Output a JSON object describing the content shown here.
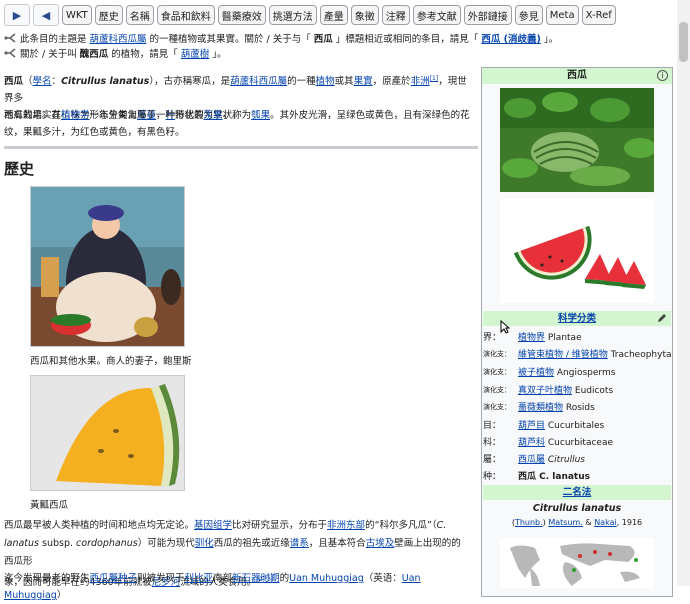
{
  "toolbar": {
    "forward_glyph": "▶",
    "back_glyph": "◀",
    "tabs": [
      "WKT",
      "歷史",
      "名稱",
      "食品和飲料",
      "醫藥療效",
      "挑選方法",
      "產量",
      "象徵",
      "注釋",
      "参考文献",
      "外部鏈接",
      "參見",
      "Meta",
      "X-Ref"
    ]
  },
  "hatnotes": {
    "line1": {
      "a": "此条目的主題是",
      "b": "葫蘆科西瓜屬",
      "c": "的一種植物或其果實。關於 / 关于与「",
      "d": "西瓜",
      "e": "」標題相近或相同的条目，請見「",
      "f": "西瓜 (消歧義)",
      "g": "」。"
    },
    "line2": {
      "a": "關於 / 关于叫",
      "b": "醜西瓜",
      "c": "的植物，請見「",
      "d": "葫蘆樹",
      "e": "」。"
    }
  },
  "intro": {
    "p1": {
      "t1": "西瓜",
      "t2": "（",
      "t3": "學名",
      "t4": "：",
      "t5": "Citrullus lanatus",
      "t6": "），古亦稱寒瓜，是",
      "t7": "葫蘆科西瓜屬",
      "t8": "的一種",
      "t9": "植物",
      "t10": "或其",
      "t11": "果實",
      "t12": "，原產於",
      "t13": "非洲",
      "t14": "[1]",
      "t15": "，現世界多",
      "line2a": "地有栽培。其植株为一年生匍匐",
      "line2b": "藤蔓",
      "line2c": "，",
      "line2d": "叶",
      "line2e": "形状裂为掌状。"
    },
    "p2": {
      "t1": "西瓜的果实在",
      "t2": "植物学",
      "t3": "形态分类上屬于一种特化的",
      "t4": "浆果",
      "t5": "，称为",
      "t6": "瓠果",
      "t7": "。其外皮光滑，呈绿色或黄色，且有深绿色的花",
      "line2": "纹，果瓤多汁，为红色或黄色，有黑色籽。"
    }
  },
  "history": {
    "heading": "歷史",
    "caption1": "西瓜和其他水果。商人的妻子，鲍里斯",
    "caption2": "黃瓤西瓜",
    "p1": {
      "t1": "西瓜最早被人类种植的时间和地点均无定论。",
      "t2": "基因组学",
      "t3": "比对研究显示，分布于",
      "t4": "非洲东部",
      "t5": "的“科尔多凡瓜”（",
      "t6": "C.",
      "l2a": "lanatus",
      "l2b": " subsp. ",
      "l2c": "cordophanus",
      "l2d": "）可能为现代",
      "l2e": "驯化",
      "l2f": "西瓜的祖先或近缘",
      "l2g": "谱系",
      "l2h": "，且基本符合",
      "l2i": "古埃及",
      "l2j": "壁画上出现的的西瓜形",
      "l3a": "象，因而可能早在约4360年前就被",
      "l3b": "尼罗河",
      "l3c": "流域的人类食用。",
      "l3d": "[2][3]"
    },
    "p2": {
      "t1": "迄今发现最老的野生",
      "t2": "西瓜屬种子",
      "t3": "则被发现于",
      "t4": "利比亚",
      "t5": "南部",
      "t6": "新石器时期",
      "t7": "的",
      "t8": "Uan Muhuggiag",
      "t9": "（英语：",
      "t10": "Uan Muhuggiag",
      "t11": "）"
    }
  },
  "infobox": {
    "title": "西瓜",
    "info_glyph": "i",
    "taxonomy_heading": "科学分类",
    "rows": [
      {
        "rank": "界：",
        "link": "植物界",
        "rest": " Plantae",
        "small": false
      },
      {
        "rank": "演化支：",
        "link": "維管束植物 / 维管植物",
        "rest": " Tracheophyta",
        "small": true
      },
      {
        "rank": "演化支：",
        "link": "被子植物",
        "rest": " Angiosperms",
        "small": true
      },
      {
        "rank": "演化支：",
        "link": "真双子叶植物",
        "rest": " Eudicots",
        "small": true
      },
      {
        "rank": "演化支：",
        "link": "薔薇類植物",
        "rest": " Rosids",
        "small": true
      },
      {
        "rank": "目：",
        "link": "葫芦目",
        "rest": " Cucurbitales",
        "small": false
      },
      {
        "rank": "科：",
        "link": "葫芦科",
        "rest": " Cucurbitaceae",
        "small": false
      },
      {
        "rank": "屬：",
        "link": "西瓜屬",
        "rest": " Citrullus",
        "small": false
      }
    ],
    "species": {
      "rank": "种：",
      "name": "西瓜 C. lanatus"
    },
    "binomial_heading": "二名法",
    "binomial": "Citrullus lanatus",
    "authority": {
      "a": "(",
      "b": "Thunb.",
      "c": ") ",
      "d": "Matsum.",
      "e": " & ",
      "f": "Nakai",
      "g": ", 1916"
    }
  },
  "colors": {
    "infobox_header": "#d3f5d0",
    "link": "#0645ad",
    "border": "#a2a9b1"
  }
}
